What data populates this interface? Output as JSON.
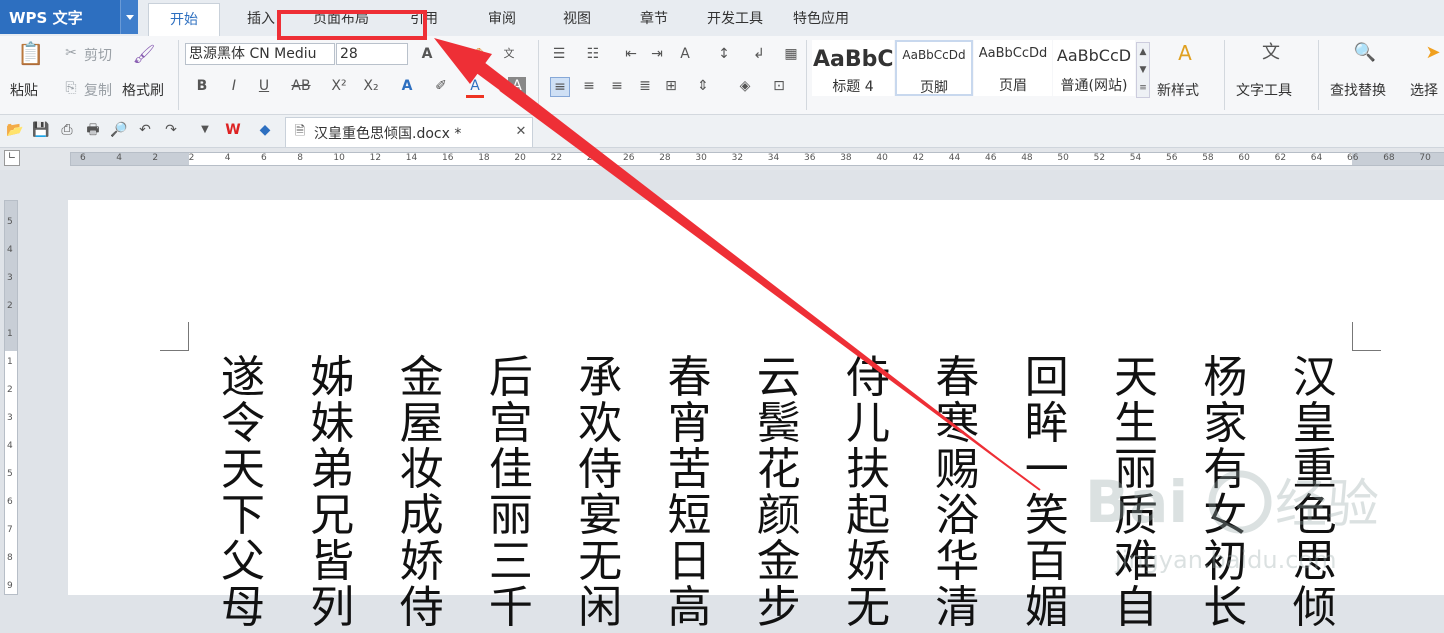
{
  "app": {
    "title": "WPS 文字"
  },
  "tabs": [
    "开始",
    "插入",
    "页面布局",
    "引用",
    "审阅",
    "视图",
    "章节",
    "开发工具",
    "特色应用"
  ],
  "ribbon": {
    "paste": "粘贴",
    "cut": "剪切",
    "copy": "复制",
    "format_painter": "格式刷",
    "font_name": "思源黑体 CN Mediu",
    "font_size": "28",
    "styles": [
      {
        "preview": "AaBbC",
        "name": "标题 4"
      },
      {
        "preview": "AaBbCcDd",
        "name": "页脚"
      },
      {
        "preview": "AaBbCcDd",
        "name": "页眉"
      },
      {
        "preview": "AaBbCcD",
        "name": "普通(网站)"
      }
    ],
    "new_style": "新样式",
    "text_tools": "文字工具",
    "find_replace": "查找替换",
    "select": "选择"
  },
  "document": {
    "tab_title": "汉皇重色思倾国.docx *"
  },
  "ruler_h": [
    "6",
    "4",
    "2",
    "2",
    "4",
    "6",
    "8",
    "10",
    "12",
    "14",
    "16",
    "18",
    "20",
    "22",
    "24",
    "26",
    "28",
    "30",
    "32",
    "34",
    "36",
    "38",
    "40",
    "42",
    "44",
    "46",
    "48",
    "50",
    "52",
    "54",
    "56",
    "58",
    "60",
    "62",
    "64",
    "66",
    "68",
    "70"
  ],
  "ruler_v": [
    "5",
    "4",
    "3",
    "2",
    "1",
    "1",
    "2",
    "3",
    "4",
    "5",
    "6",
    "7",
    "8",
    "9"
  ],
  "columns": [
    "遂令天下父母",
    "姊妹弟兄皆列",
    "金屋妆成娇侍",
    "后宫佳丽三千",
    "承欢侍宴无闲",
    "春宵苦短日高",
    "云鬓花颜金步",
    "侍儿扶起娇无",
    "春寒赐浴华清",
    "回眸一笑百媚",
    "天生丽质难自",
    "杨家有女初长",
    "汉皇重色思倾"
  ],
  "watermark": "Bai 经验 jingyan.baidu.com",
  "annotation": {
    "highlight_color": "#ee2f36",
    "target": "页面布局"
  }
}
